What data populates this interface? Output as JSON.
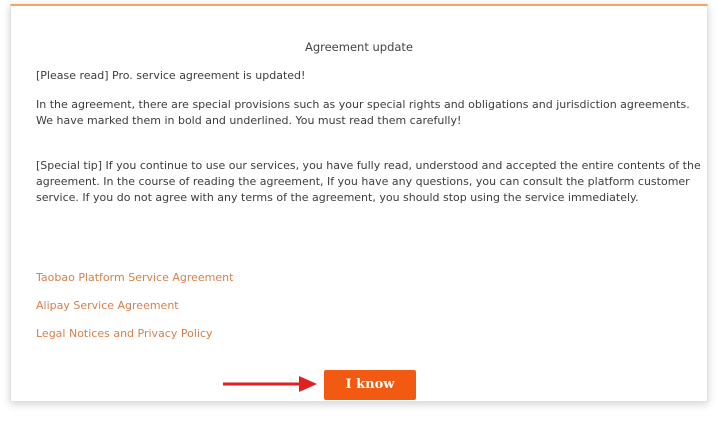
{
  "dialog": {
    "title": "Agreement update",
    "notice": "[Please read] Pro. service agreement is updated!",
    "paragraph_1": "In the agreement, there are special provisions such as your special rights and obligations and jurisdiction agreements. We have marked them in bold and underlined. You must read them carefully!",
    "paragraph_2": "[Special tip] If you continue to use our services, you have fully read, understood and accepted the entire contents of the agreement. In the course of reading the agreement, If you have any questions, you can consult the platform customer service. If you do not agree with any terms of the agreement, you should stop using the service immediately.",
    "links": [
      "Taobao Platform Service Agreement",
      "Alipay Service Agreement",
      "Legal Notices and Privacy Policy"
    ],
    "confirm_label": "I know"
  },
  "colors": {
    "accent_border": "#f2a667",
    "link": "#d4804c",
    "button": "#f25a11",
    "arrow": "#e02020"
  },
  "icons": {
    "annotation": "red-arrow-icon"
  }
}
